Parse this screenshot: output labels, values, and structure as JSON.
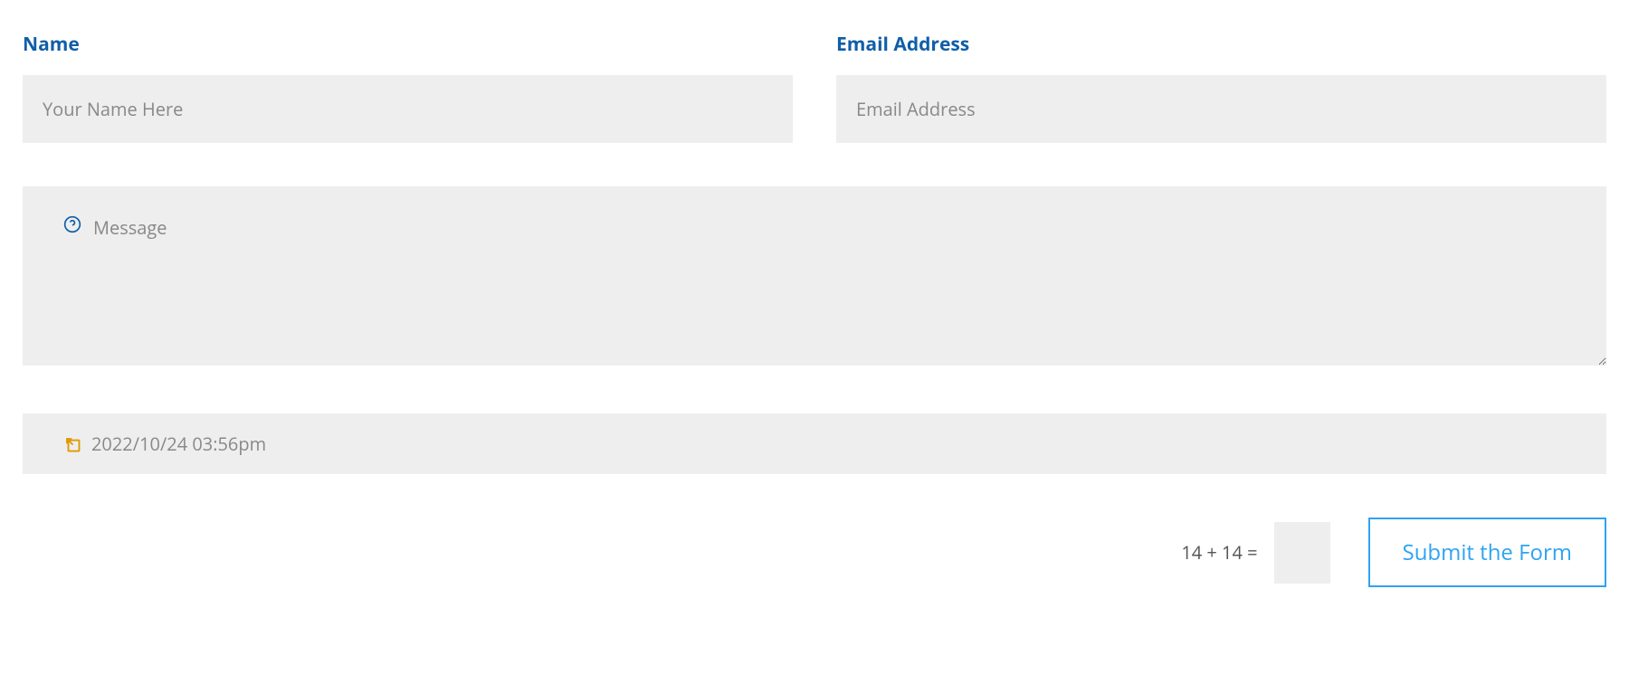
{
  "form": {
    "name": {
      "label": "Name",
      "placeholder": "Your Name Here",
      "value": ""
    },
    "email": {
      "label": "Email Address",
      "placeholder": "Email Address",
      "value": ""
    },
    "message": {
      "placeholder": "Message",
      "value": ""
    },
    "datetime": {
      "value": "2022/10/24 03:56pm"
    },
    "captcha": {
      "question": "14 + 14 =",
      "value": ""
    },
    "submit_label": "Submit the Form"
  },
  "icons": {
    "help": "help-circle-icon",
    "calendar": "calendar-arrow-icon"
  },
  "colors": {
    "label_blue": "#105ea8",
    "accent_blue": "#2ea3f2",
    "input_bg": "#eeeeee",
    "icon_orange": "#e09900"
  }
}
